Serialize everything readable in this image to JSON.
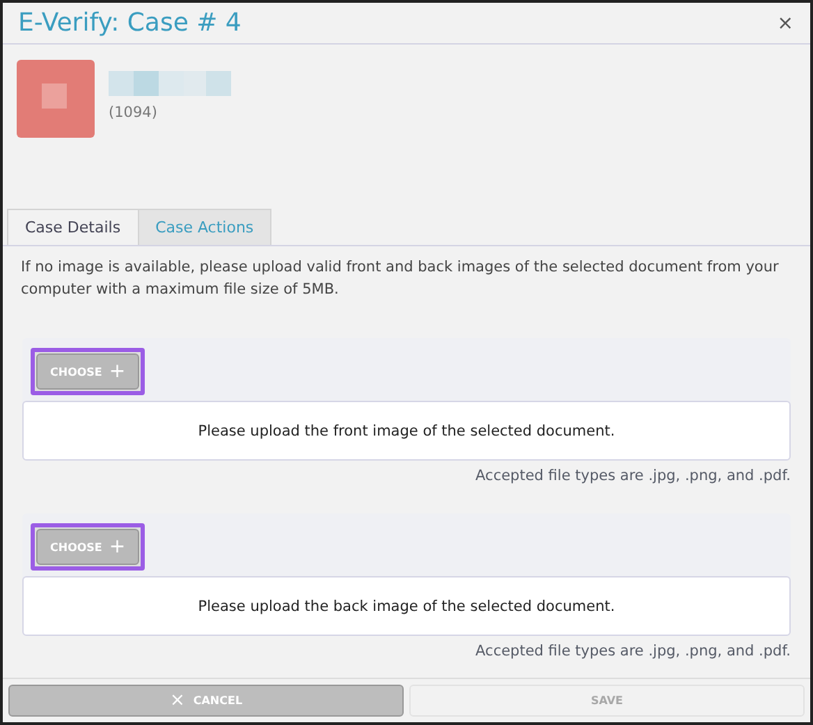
{
  "window": {
    "title": "E-Verify: Case # 4",
    "close": "×"
  },
  "profile": {
    "id": "(1094)"
  },
  "tabs": [
    {
      "label": "Case Details",
      "selected": false
    },
    {
      "label": "Case Actions",
      "selected": true
    }
  ],
  "instructions": "If no image is available, please upload valid front and back images of the selected document from your computer with a maximum file size of 5MB.",
  "uploads": [
    {
      "button": "CHOOSE",
      "button_icon": "+",
      "highlighted": true,
      "prompt": "Please upload the front image of the selected document.",
      "note": "Accepted file types are .jpg, .png, and .pdf."
    },
    {
      "button": "CHOOSE",
      "button_icon": "+",
      "highlighted": true,
      "prompt": "Please upload the back image of the selected document.",
      "note": "Accepted file types are .jpg, .png, and .pdf."
    }
  ],
  "footer": [
    {
      "label": "CANCEL",
      "icon": "×",
      "disabled": false
    },
    {
      "label": "SAVE",
      "disabled": true
    }
  ]
}
